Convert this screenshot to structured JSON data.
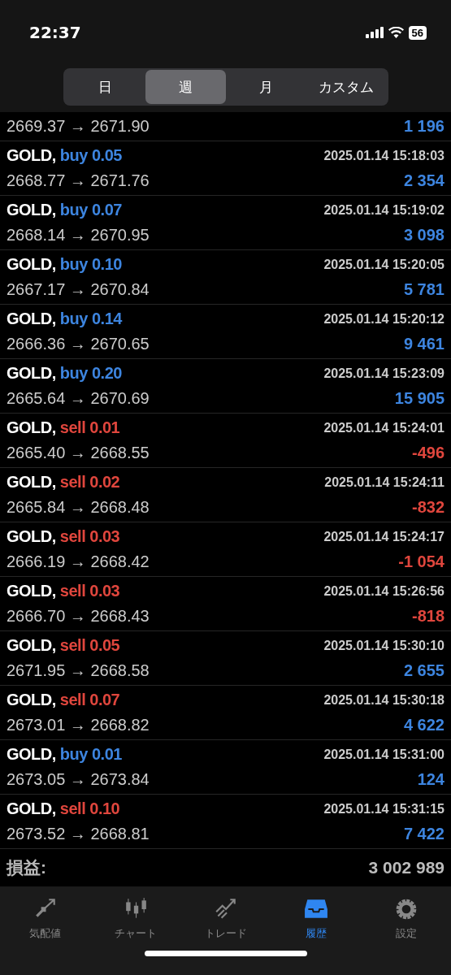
{
  "status_bar": {
    "time": "22:37",
    "battery": "56"
  },
  "period_tabs": [
    {
      "label": "日",
      "selected": false
    },
    {
      "label": "週",
      "selected": true
    },
    {
      "label": "月",
      "selected": false
    },
    {
      "label": "カスタム",
      "selected": false
    }
  ],
  "deals": [
    {
      "prices": "2669.37 → 2671.90",
      "profit": "1 196",
      "loss": false
    },
    {
      "symbol": "GOLD,",
      "side": "buy",
      "volume": "0.05",
      "time": "2025.01.14 15:18:03",
      "prices": "2668.77 → 2671.76",
      "profit": "2 354",
      "loss": false
    },
    {
      "symbol": "GOLD,",
      "side": "buy",
      "volume": "0.07",
      "time": "2025.01.14 15:19:02",
      "prices": "2668.14 → 2670.95",
      "profit": "3 098",
      "loss": false
    },
    {
      "symbol": "GOLD,",
      "side": "buy",
      "volume": "0.10",
      "time": "2025.01.14 15:20:05",
      "prices": "2667.17 → 2670.84",
      "profit": "5 781",
      "loss": false
    },
    {
      "symbol": "GOLD,",
      "side": "buy",
      "volume": "0.14",
      "time": "2025.01.14 15:20:12",
      "prices": "2666.36 → 2670.65",
      "profit": "9 461",
      "loss": false
    },
    {
      "symbol": "GOLD,",
      "side": "buy",
      "volume": "0.20",
      "time": "2025.01.14 15:23:09",
      "prices": "2665.64 → 2670.69",
      "profit": "15 905",
      "loss": false
    },
    {
      "symbol": "GOLD,",
      "side": "sell",
      "volume": "0.01",
      "time": "2025.01.14 15:24:01",
      "prices": "2665.40 → 2668.55",
      "profit": "-496",
      "loss": true
    },
    {
      "symbol": "GOLD,",
      "side": "sell",
      "volume": "0.02",
      "time": "2025.01.14 15:24:11",
      "prices": "2665.84 → 2668.48",
      "profit": "-832",
      "loss": true
    },
    {
      "symbol": "GOLD,",
      "side": "sell",
      "volume": "0.03",
      "time": "2025.01.14 15:24:17",
      "prices": "2666.19 → 2668.42",
      "profit": "-1 054",
      "loss": true
    },
    {
      "symbol": "GOLD,",
      "side": "sell",
      "volume": "0.03",
      "time": "2025.01.14 15:26:56",
      "prices": "2666.70 → 2668.43",
      "profit": "-818",
      "loss": true
    },
    {
      "symbol": "GOLD,",
      "side": "sell",
      "volume": "0.05",
      "time": "2025.01.14 15:30:10",
      "prices": "2671.95 → 2668.58",
      "profit": "2 655",
      "loss": false
    },
    {
      "symbol": "GOLD,",
      "side": "sell",
      "volume": "0.07",
      "time": "2025.01.14 15:30:18",
      "prices": "2673.01 → 2668.82",
      "profit": "4 622",
      "loss": false
    },
    {
      "symbol": "GOLD,",
      "side": "buy",
      "volume": "0.01",
      "time": "2025.01.14 15:31:00",
      "prices": "2673.05 → 2673.84",
      "profit": "124",
      "loss": false
    },
    {
      "symbol": "GOLD,",
      "side": "sell",
      "volume": "0.10",
      "time": "2025.01.14 15:31:15",
      "prices": "2673.52 → 2668.81",
      "profit": "7 422",
      "loss": false
    }
  ],
  "summary": {
    "label": "損益:",
    "value": "3 002 989"
  },
  "nav": [
    {
      "kind": "quotes",
      "label": "気配値",
      "selected": false
    },
    {
      "kind": "chart",
      "label": "チャート",
      "selected": false
    },
    {
      "kind": "trade",
      "label": "トレード",
      "selected": false
    },
    {
      "kind": "history",
      "label": "履歴",
      "selected": true
    },
    {
      "kind": "settings",
      "label": "設定",
      "selected": false
    }
  ]
}
